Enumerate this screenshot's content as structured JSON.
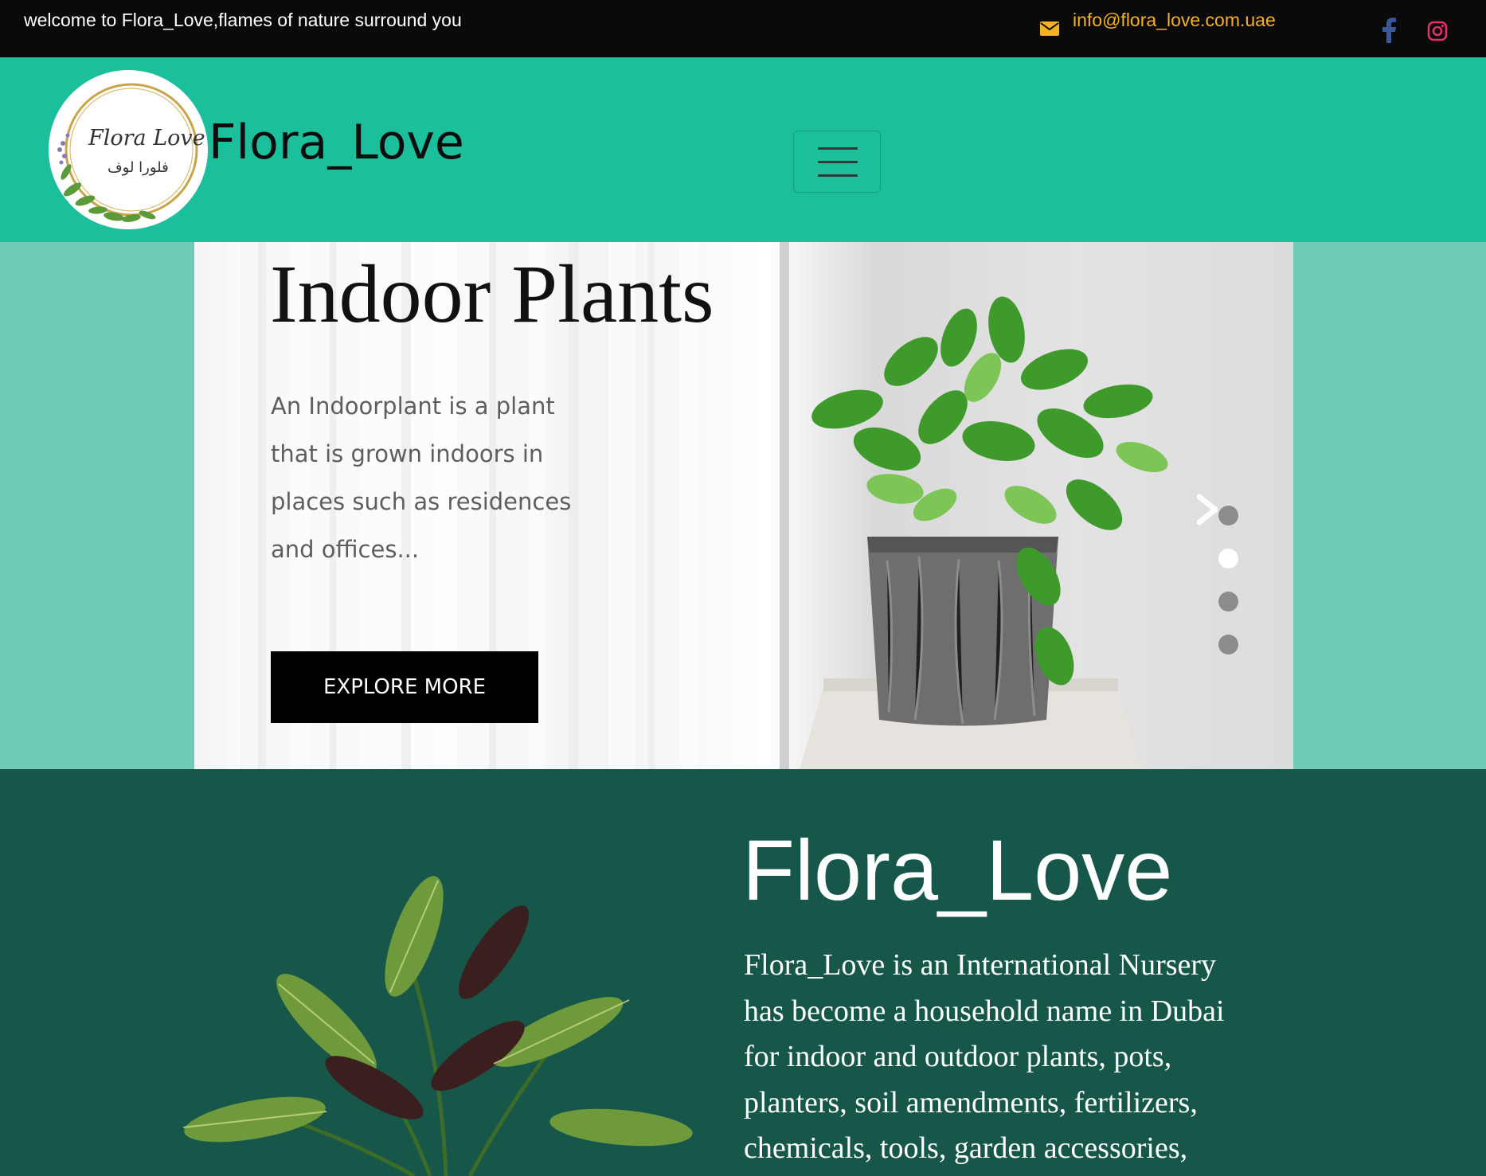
{
  "topbar": {
    "welcome_text": "welcome to Flora_Love,flames of nature surround you",
    "email": "info@flora_love.com.uae",
    "icons": [
      "envelope-icon",
      "facebook-icon",
      "instagram-icon"
    ]
  },
  "header": {
    "logo": {
      "script_text": "Flora Love",
      "arabic_text": "فلورا لوف"
    },
    "brand": "Flora_Love",
    "menu_icon": "hamburger-icon"
  },
  "hero": {
    "title": "Indoor Plants",
    "description": "An Indoorplant is a plant that is grown indoors in places such as residences and offices...",
    "button_label": "EXPLORE MORE",
    "slide_count": 4,
    "active_slide": 2
  },
  "about": {
    "title": "Flora_Love",
    "text": "Flora_Love is an International Nursery has become a household name in Dubai for indoor and outdoor plants, pots, planters, soil amendments, fertilizers, chemicals, tools, garden accessories,"
  },
  "colors": {
    "topbar_bg": "#0a0a0a",
    "email_color": "#f5b21f",
    "header_bg": "#1bbf9c",
    "hero_bg": "#6fcab6",
    "about_bg": "#16574a",
    "button_bg": "#000000",
    "facebook": "#3b5998",
    "instagram": "#e1306c"
  }
}
